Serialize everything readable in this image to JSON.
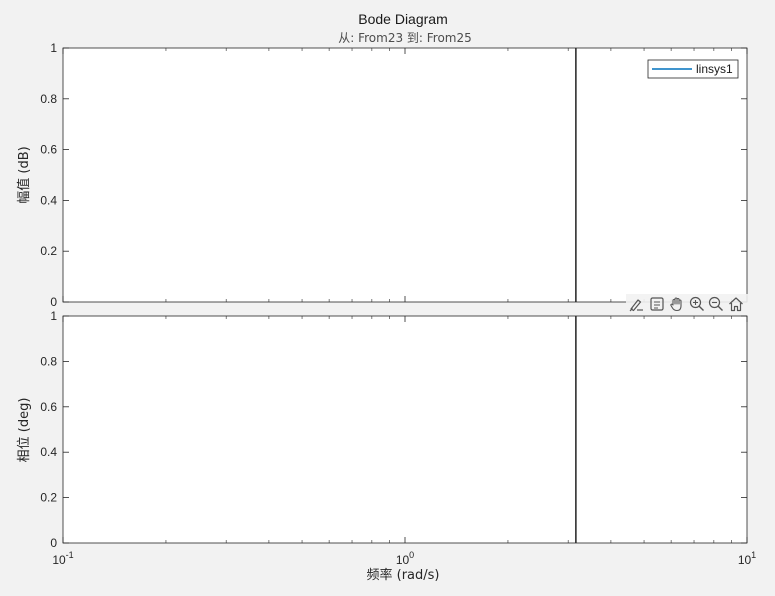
{
  "chart_data": {
    "type": "line",
    "title": "Bode Diagram",
    "subtitle": "从: From23  到: From25",
    "xlabel": "频率  (rad/s)",
    "xscale": "log",
    "xlim": [
      0.1,
      10
    ],
    "x_ticks": [
      {
        "value": 0.1,
        "base": "10",
        "exp": "-1"
      },
      {
        "value": 1,
        "base": "10",
        "exp": "0"
      },
      {
        "value": 10,
        "base": "10",
        "exp": "1"
      }
    ],
    "vertical_line_x": 3.16,
    "legend": {
      "location": "top-right",
      "entries": [
        {
          "name": "linsys1",
          "color": "#0072bd"
        }
      ]
    },
    "subplots": [
      {
        "id": "magnitude",
        "ylabel": "幅值 (dB)",
        "ylim": [
          0,
          1
        ],
        "yticks": [
          "0",
          "0.2",
          "0.4",
          "0.6",
          "0.8",
          "1"
        ]
      },
      {
        "id": "phase",
        "ylabel": "相位 (deg)",
        "ylim": [
          0,
          1
        ],
        "yticks": [
          "0",
          "0.2",
          "0.4",
          "0.6",
          "0.8",
          "1"
        ]
      }
    ],
    "series": [
      {
        "name": "linsys1",
        "color": "#0072bd",
        "x": [],
        "y": []
      }
    ]
  },
  "toolbar": {
    "buttons": [
      {
        "name": "brush-icon",
        "label": "Brush"
      },
      {
        "name": "data-tips-icon",
        "label": "Data Tips"
      },
      {
        "name": "pan-hand-icon",
        "label": "Pan"
      },
      {
        "name": "zoom-in-icon",
        "label": "Zoom In"
      },
      {
        "name": "zoom-out-icon",
        "label": "Zoom Out"
      },
      {
        "name": "home-icon",
        "label": "Restore View"
      }
    ]
  },
  "colors": {
    "background": "#f2f2f2",
    "axes_background": "#ffffff",
    "axes_border": "#262626",
    "tick": "#262626",
    "vertical_line": "#000000",
    "series": "#0072bd"
  }
}
